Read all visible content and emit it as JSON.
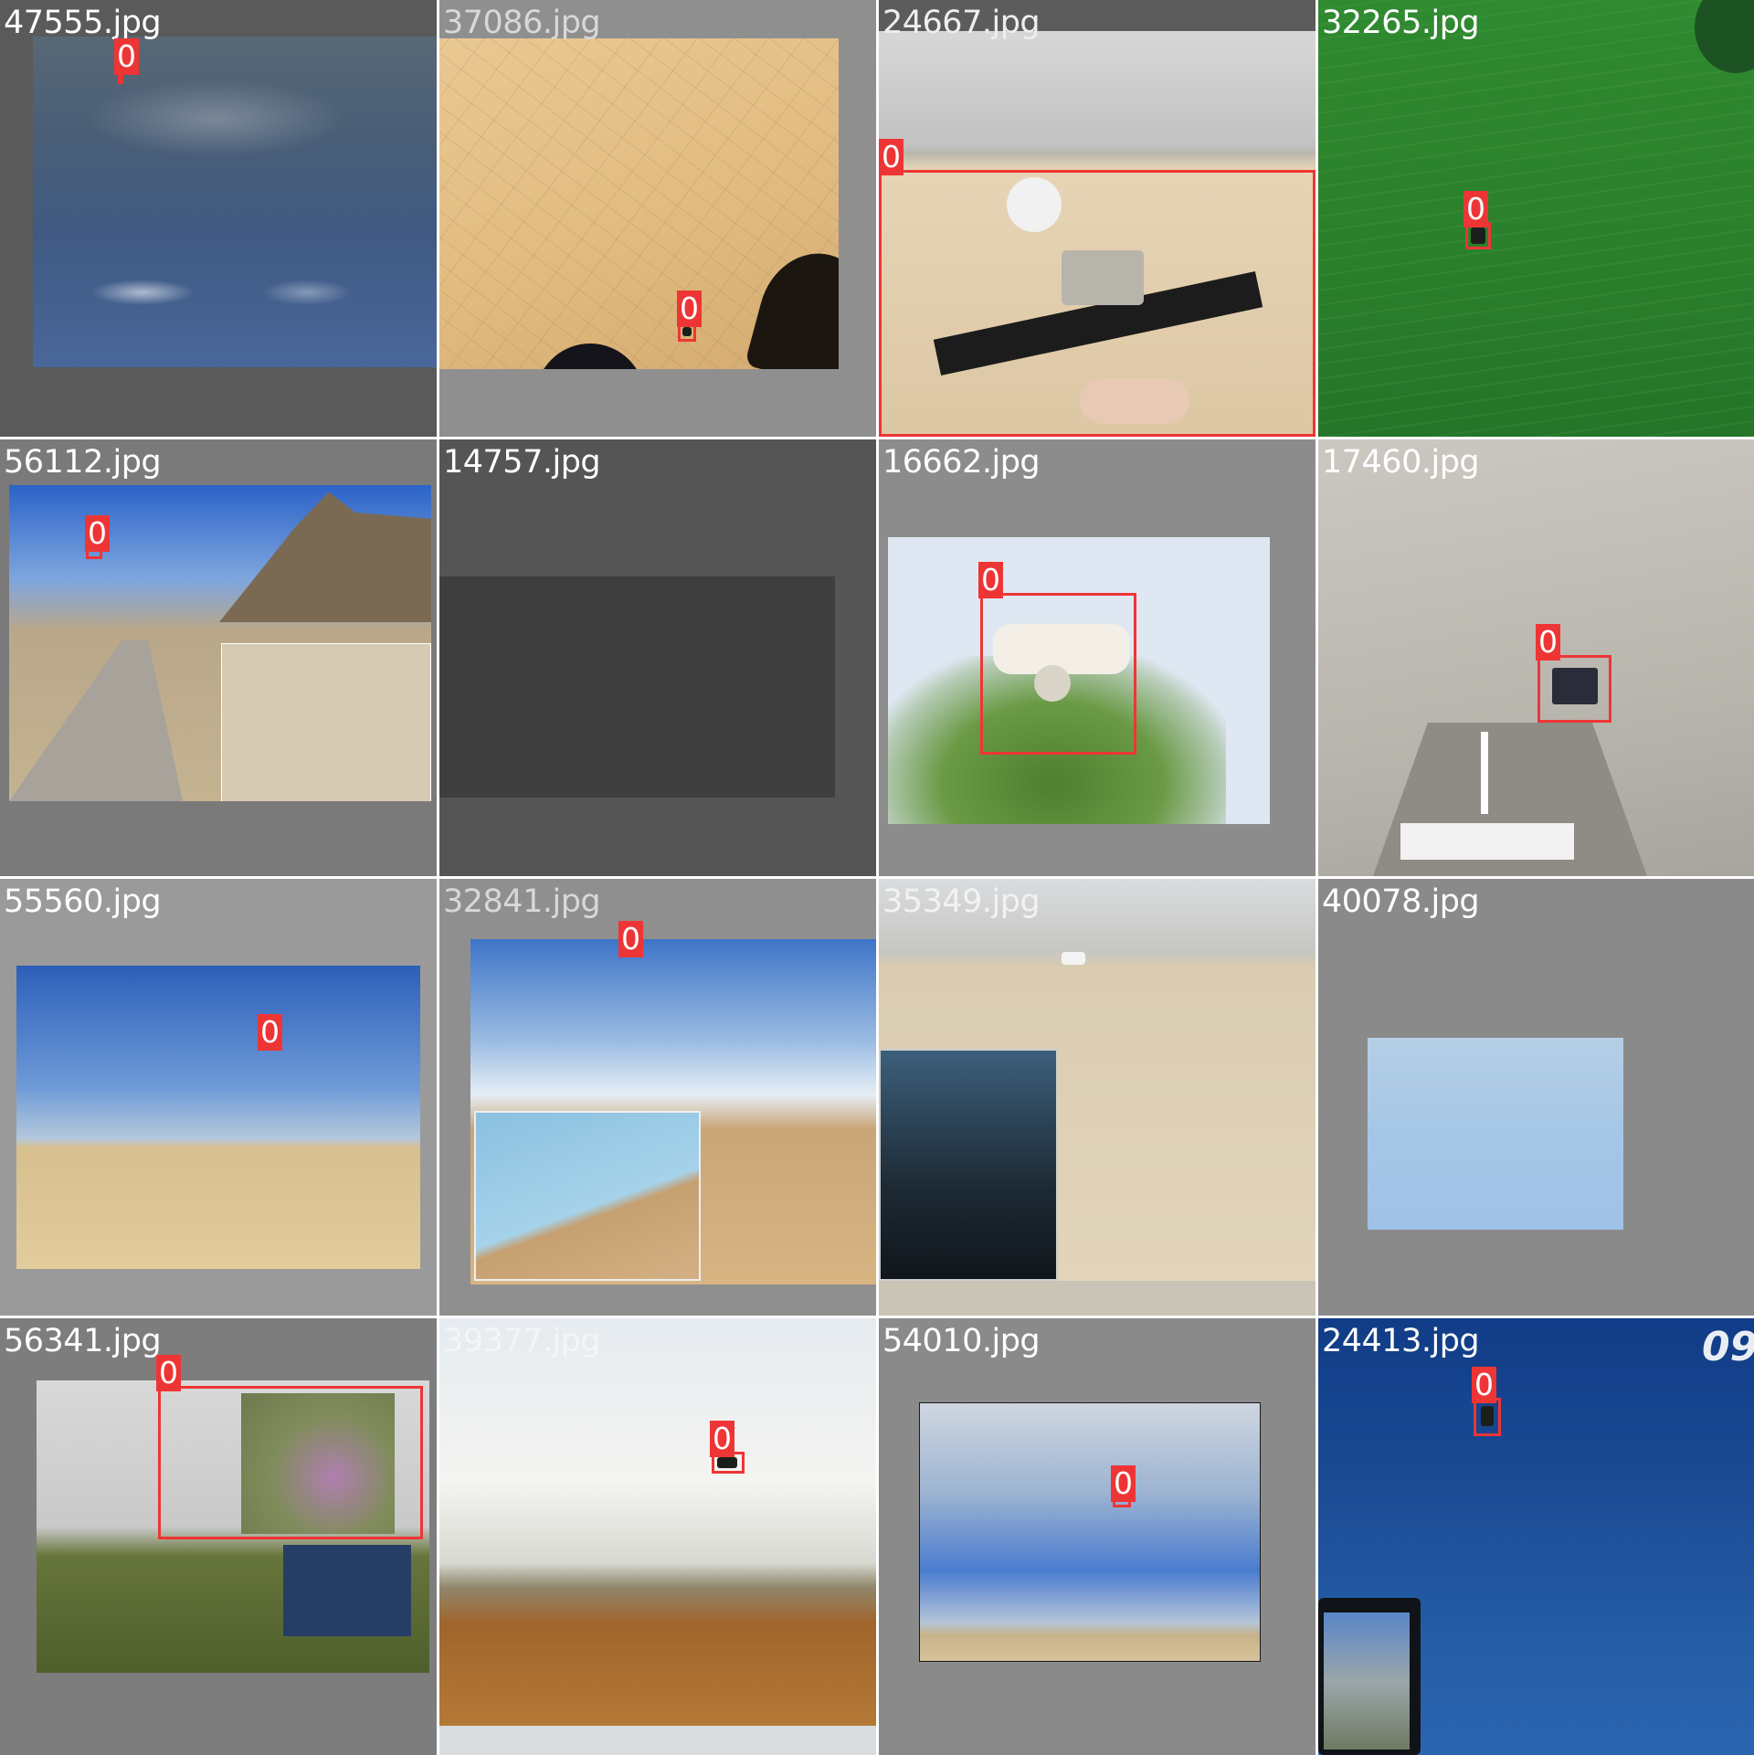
{
  "grid": {
    "rows": 4,
    "columns": 4
  },
  "tiles": [
    {
      "filename": "47555.jpg",
      "frame": "#5a5a5a",
      "scene": "dark-blue-sky",
      "detections": [
        {
          "label": "0"
        }
      ]
    },
    {
      "filename": "37086.jpg",
      "frame": "#8f8f8f",
      "scene": "cracked-desert-ground",
      "detections": [
        {
          "label": "0"
        }
      ]
    },
    {
      "filename": "24667.jpg",
      "frame": "#5c5c5c",
      "scene": "desert-quadcopter-closeup",
      "detections": [
        {
          "label": "0"
        }
      ]
    },
    {
      "filename": "32265.jpg",
      "frame": "#2b7a2b",
      "scene": "green-water",
      "detections": [
        {
          "label": "0"
        }
      ]
    },
    {
      "filename": "56112.jpg",
      "frame": "#7a7a7a",
      "scene": "mountain-road",
      "detections": [
        {
          "label": "0"
        }
      ]
    },
    {
      "filename": "14757.jpg",
      "frame": "#555555",
      "scene": "dark-frame",
      "detections": []
    },
    {
      "filename": "16662.jpg",
      "frame": "#8c8c8c",
      "scene": "white-drone-over-tree",
      "detections": [
        {
          "label": "0"
        }
      ]
    },
    {
      "filename": "17460.jpg",
      "frame": "#bdbab2",
      "scene": "indoor-ceiling",
      "detections": [
        {
          "label": "0"
        }
      ]
    },
    {
      "filename": "55560.jpg",
      "frame": "#9a9a9a",
      "scene": "blue-sky-sand",
      "detections": [
        {
          "label": "0"
        }
      ]
    },
    {
      "filename": "32841.jpg",
      "frame": "#8f8f8f",
      "scene": "desert-with-inset",
      "detections": [
        {
          "label": "0"
        }
      ]
    },
    {
      "filename": "35349.jpg",
      "frame": "#c9c4b6",
      "scene": "desert-with-goggles",
      "detections": []
    },
    {
      "filename": "40078.jpg",
      "frame": "#8a8a8a",
      "scene": "pale-blue-sky",
      "detections": []
    },
    {
      "filename": "56341.jpg",
      "frame": "#7d7d7d",
      "scene": "grass-trees",
      "detections": [
        {
          "label": "0"
        }
      ]
    },
    {
      "filename": "39377.jpg",
      "frame": "#d9dde0",
      "scene": "cloudy-sky-plain",
      "detections": [
        {
          "label": "0"
        }
      ]
    },
    {
      "filename": "54010.jpg",
      "frame": "#8a8a8a",
      "scene": "cloudy-blue-sky",
      "detections": [
        {
          "label": "0"
        }
      ]
    },
    {
      "filename": "24413.jpg",
      "frame": "#183f82",
      "scene": "deep-blue-sky",
      "detections": [
        {
          "label": "0"
        }
      ]
    }
  ],
  "colors": {
    "box": "#ee3535",
    "label_text": "#ffffff",
    "filename_text": "#ffffff"
  },
  "watermark_text": "09"
}
